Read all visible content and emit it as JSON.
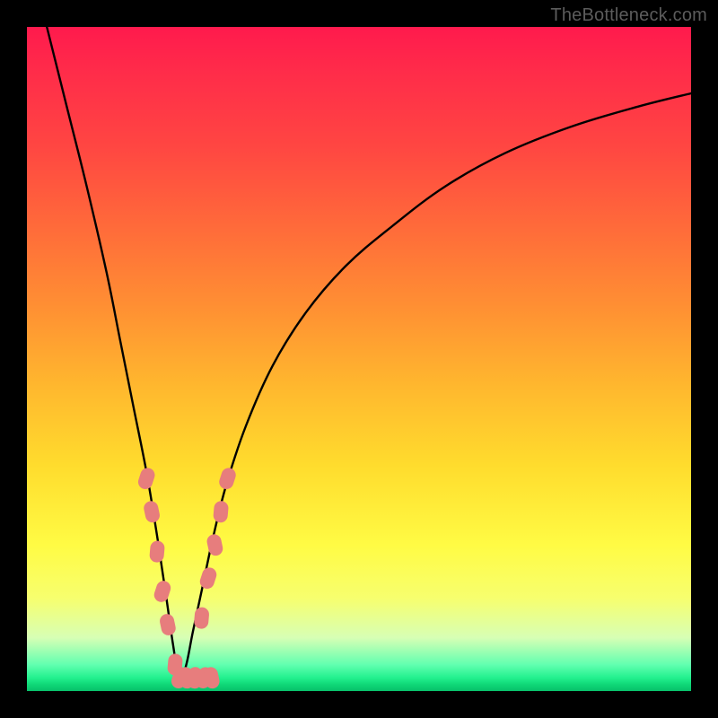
{
  "watermark": "TheBottleneck.com",
  "colors": {
    "curve_stroke": "#000000",
    "marker_fill": "#e77d7d",
    "frame": "#000000"
  },
  "chart_data": {
    "type": "line",
    "title": "",
    "xlabel": "",
    "ylabel": "",
    "xlim": [
      0,
      100
    ],
    "ylim": [
      0,
      100
    ],
    "note": "Axes have no visible tick labels; x and y values are read in percent of plot width/height. y=0 is the bottom (green) edge, y=100 is the top (red) edge. The curve is a V-shaped bottleneck function with its minimum near x≈23.",
    "series": [
      {
        "name": "bottleneck-curve",
        "x": [
          3,
          6,
          9,
          12,
          14,
          16,
          18,
          19.5,
          21,
          22,
          23,
          24,
          25,
          26.5,
          28,
          30,
          33,
          37,
          42,
          48,
          55,
          63,
          72,
          82,
          92,
          100
        ],
        "y": [
          100,
          88,
          76,
          63,
          53,
          43,
          33,
          24,
          14,
          7,
          1.5,
          4,
          9,
          16,
          23,
          31,
          40,
          49,
          57,
          64,
          70,
          76,
          81,
          85,
          88,
          90
        ]
      }
    ],
    "markers": {
      "name": "highlight-dots",
      "note": "Salmon rounded markers clustered near the valley of the curve on both arms.",
      "points": [
        {
          "x": 18.0,
          "y": 32
        },
        {
          "x": 18.8,
          "y": 27
        },
        {
          "x": 19.6,
          "y": 21
        },
        {
          "x": 20.4,
          "y": 15
        },
        {
          "x": 21.2,
          "y": 10
        },
        {
          "x": 22.3,
          "y": 4
        },
        {
          "x": 23.0,
          "y": 2
        },
        {
          "x": 24.0,
          "y": 2
        },
        {
          "x": 25.3,
          "y": 2
        },
        {
          "x": 26.7,
          "y": 2
        },
        {
          "x": 27.8,
          "y": 2
        },
        {
          "x": 26.3,
          "y": 11
        },
        {
          "x": 27.3,
          "y": 17
        },
        {
          "x": 28.3,
          "y": 22
        },
        {
          "x": 29.2,
          "y": 27
        },
        {
          "x": 30.2,
          "y": 32
        }
      ]
    }
  }
}
